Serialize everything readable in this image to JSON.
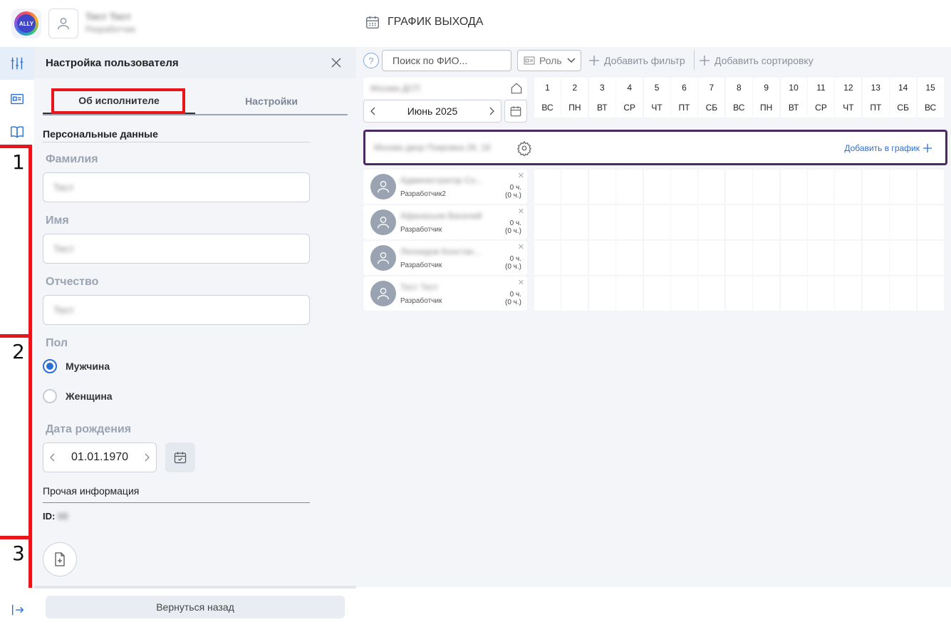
{
  "header": {
    "logo_text": "ALLY",
    "user_name": "Тест Тест",
    "user_role": "Разработчик",
    "page_title": "ГРАФИК ВЫХОДА"
  },
  "panel": {
    "title": "Настройка пользователя",
    "tabs": [
      {
        "label": "Об исполнителе",
        "active": true
      },
      {
        "label": "Настройки",
        "active": false
      }
    ],
    "personal_title": "Персональные данные",
    "fields": {
      "surname_label": "Фамилия",
      "surname_value": "Тест",
      "name_label": "Имя",
      "name_value": "Тест",
      "patronymic_label": "Отчество",
      "patronymic_value": "Тест"
    },
    "gender": {
      "label": "Пол",
      "options": [
        {
          "label": "Мужчина",
          "selected": true
        },
        {
          "label": "Женщина",
          "selected": false
        }
      ]
    },
    "birth": {
      "label": "Дата рождения",
      "value": "01.01.1970"
    },
    "other_title": "Прочая информация",
    "id_label": "ID:",
    "id_value": "00",
    "back_label": "Вернуться назад"
  },
  "annotations": [
    "1",
    "2",
    "3"
  ],
  "toolbar": {
    "search_placeholder": "Поиск по ФИО...",
    "role_label": "Роль",
    "add_filter": "Добавить фильтр",
    "add_sort": "Добавить сортировку"
  },
  "schedule": {
    "org_name": "Москва ДСП",
    "month": "Июнь 2025",
    "days": [
      {
        "n": "1",
        "d": "ВС"
      },
      {
        "n": "2",
        "d": "ПН"
      },
      {
        "n": "3",
        "d": "ВТ"
      },
      {
        "n": "4",
        "d": "СР"
      },
      {
        "n": "5",
        "d": "ЧТ"
      },
      {
        "n": "6",
        "d": "ПТ"
      },
      {
        "n": "7",
        "d": "СБ"
      },
      {
        "n": "8",
        "d": "ВС"
      },
      {
        "n": "9",
        "d": "ПН"
      },
      {
        "n": "10",
        "d": "ВТ"
      },
      {
        "n": "11",
        "d": "СР"
      },
      {
        "n": "12",
        "d": "ЧТ"
      },
      {
        "n": "13",
        "d": "ПТ"
      },
      {
        "n": "14",
        "d": "СБ"
      },
      {
        "n": "15",
        "d": "ВС"
      }
    ],
    "group_name": "Москва двор Покровка 26, 18",
    "add_to_schedule": "Добавить в график",
    "employees": [
      {
        "name": "Администратор Со...",
        "role": "Разработчик2",
        "hours": "0 ч.",
        "hours_sub": "(0 ч.)"
      },
      {
        "name": "Афанасьев Василий",
        "role": "Разработчик",
        "hours": "0 ч.",
        "hours_sub": "(0 ч.)"
      },
      {
        "name": "Леонидов Констан...",
        "role": "Разработчик",
        "hours": "0 ч.",
        "hours_sub": "(0 ч.)"
      },
      {
        "name": "Тест Тест",
        "role": "Разработчик",
        "hours": "0 ч.",
        "hours_sub": "(0 ч.)"
      }
    ]
  },
  "colors": {
    "accent": "#2b6fd6",
    "highlight": "#e8161b",
    "group_border": "#4a2a62"
  }
}
